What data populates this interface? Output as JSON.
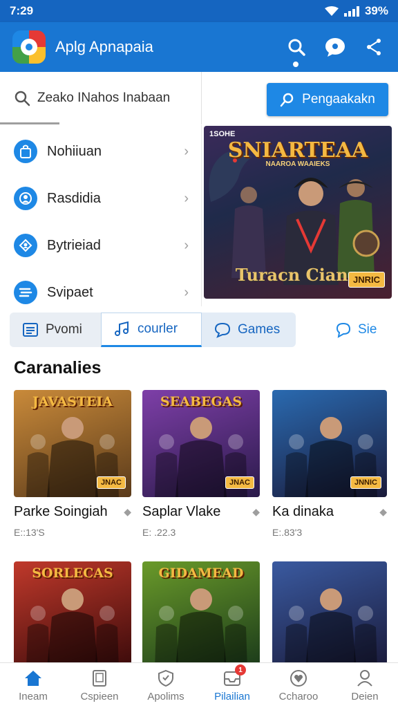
{
  "status_bar": {
    "time": "7:29",
    "battery": "39%"
  },
  "app_bar": {
    "title": "Aplg Apnapaia",
    "icons": [
      "search-icon",
      "chat-icon",
      "share-icon"
    ]
  },
  "search": {
    "text": "Zeako INahos Inabaan",
    "button_label": "Pengaakakn"
  },
  "side_menu": {
    "items": [
      {
        "label": "Nohiiuan",
        "icon": "bag-icon"
      },
      {
        "label": "Rasdidia",
        "icon": "user-circle-icon"
      },
      {
        "label": "Bytrieiad",
        "icon": "profile-icon"
      },
      {
        "label": "Svipaet",
        "icon": "list-icon"
      }
    ]
  },
  "hero": {
    "badge": "1SOHE",
    "title": "SNIARTEAA",
    "subtitle": "NAAROA WAAIEKS",
    "caption": "Turacn Cianu",
    "tag": "JNRIC"
  },
  "tabs": [
    {
      "label": "Pvomi",
      "icon": "document-icon"
    },
    {
      "label": "courler",
      "icon": "music-icon"
    },
    {
      "label": "Games",
      "icon": "chat-icon"
    },
    {
      "label": "Sie",
      "icon": "chat-icon"
    }
  ],
  "section": {
    "title": "Caranalies"
  },
  "cards": [
    {
      "name": "Parke Soingiah",
      "meta": "E::13'S",
      "art_title": "JAVASTEIA",
      "tag": "JNAC",
      "colors": [
        "#c98a3a",
        "#5a3a1a"
      ]
    },
    {
      "name": "Saplar Vlake",
      "meta": "E: .22.3",
      "art_title": "SEABEGAS",
      "tag": "JNAC",
      "colors": [
        "#7e3fa8",
        "#2a1a4a"
      ]
    },
    {
      "name": "Ka dinaka",
      "meta": "E:.83'3",
      "art_title": "",
      "tag": "JNNIC",
      "colors": [
        "#2a6ab0",
        "#1a1a3a"
      ]
    },
    {
      "name": "",
      "meta": "",
      "art_title": "SORLECAS",
      "tag": "",
      "colors": [
        "#c0392b",
        "#3a0a0a"
      ]
    },
    {
      "name": "",
      "meta": "",
      "art_title": "GIDAMEAD",
      "tag": "",
      "colors": [
        "#6a9a2a",
        "#1a3a1a"
      ]
    },
    {
      "name": "",
      "meta": "",
      "art_title": "",
      "tag": "",
      "colors": [
        "#3a5aa0",
        "#1a1a3a"
      ]
    }
  ],
  "bottom_nav": [
    {
      "label": "Ineam",
      "icon": "home-icon",
      "active": true
    },
    {
      "label": "Cspieen",
      "icon": "tablet-icon",
      "active": false
    },
    {
      "label": "Apolims",
      "icon": "shield-icon",
      "active": false
    },
    {
      "label": "Pilailian",
      "icon": "inbox-icon",
      "active": false,
      "badge": "1"
    },
    {
      "label": "Ccharoo",
      "icon": "heart-circle-icon",
      "active": false
    },
    {
      "label": "Deien",
      "icon": "person-icon",
      "active": false
    }
  ]
}
